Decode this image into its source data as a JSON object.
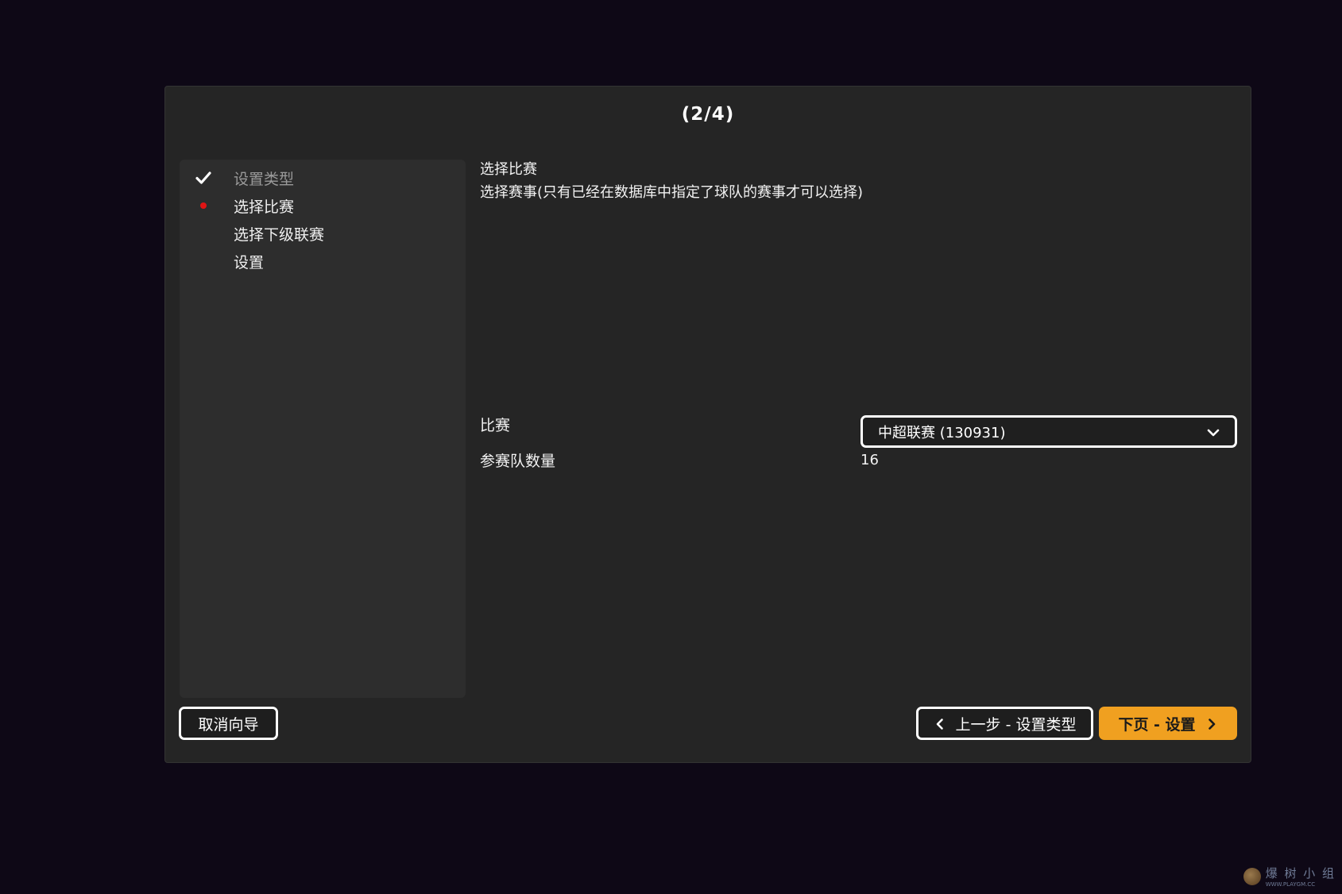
{
  "wizard": {
    "title": "(2/4)",
    "steps": [
      {
        "label": "设置类型",
        "status": "done"
      },
      {
        "label": "选择比赛",
        "status": "current"
      },
      {
        "label": "选择下级联赛",
        "status": "pending"
      },
      {
        "label": "设置",
        "status": "pending"
      }
    ]
  },
  "content": {
    "heading": "选择比赛",
    "description": "选择赛事(只有已经在数据库中指定了球队的赛事才可以选择)",
    "competition_label": "比赛",
    "competition_value": "中超联赛 (130931)",
    "team_count_label": "参赛队数量",
    "team_count_value": "16"
  },
  "buttons": {
    "cancel": "取消向导",
    "prev": "上一步 - 设置类型",
    "next": "下页 - 设置"
  },
  "watermark": {
    "text": "爆 树 小 组",
    "url": "WWW.PLAYGM.CC"
  },
  "colors": {
    "background": "#0e0816",
    "dialog": "#252525",
    "panel": "#2d2d2d",
    "accent": "#f0a020",
    "current_dot": "#e01414"
  },
  "icons": {
    "done": "checkmark-icon",
    "current": "red-dot-icon",
    "select": "chevron-down-icon",
    "prev": "chevron-left-icon",
    "next": "chevron-right-icon"
  }
}
